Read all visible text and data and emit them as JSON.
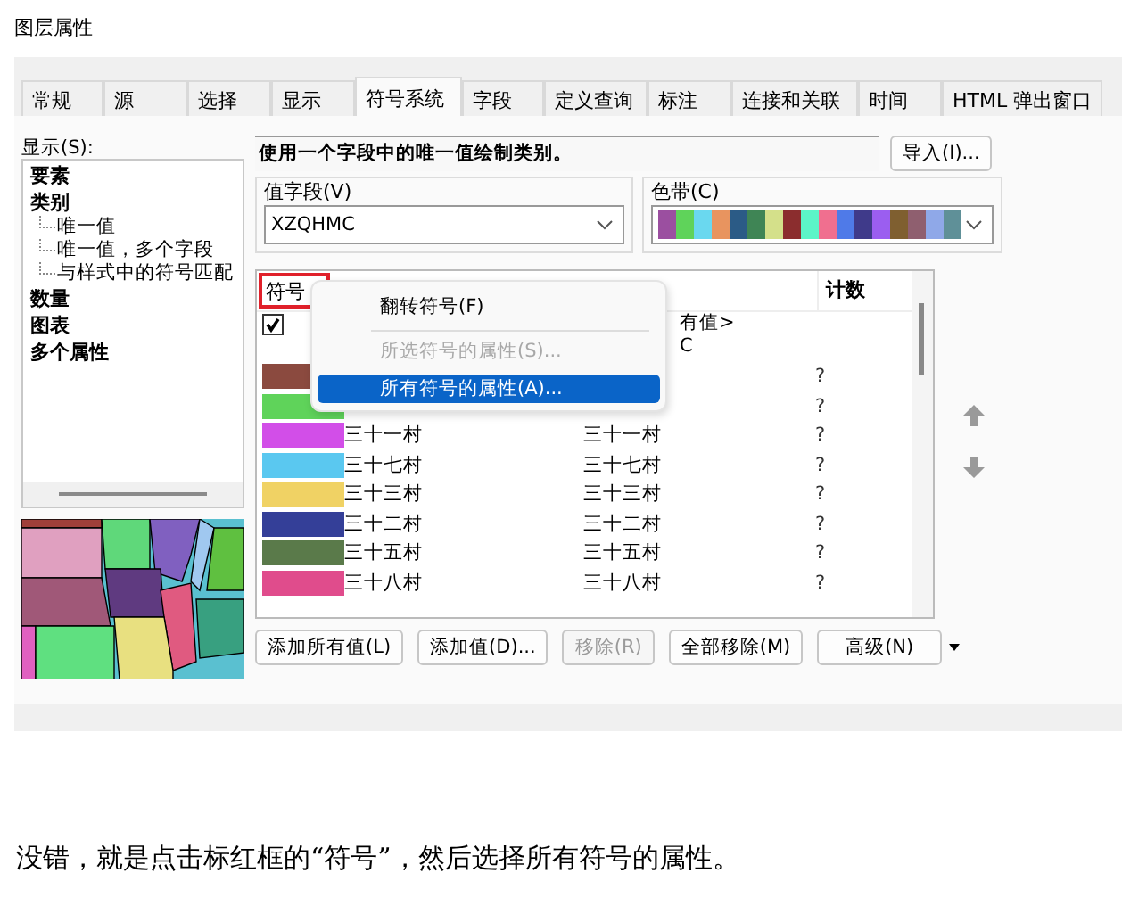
{
  "window": {
    "title": "图层属性"
  },
  "tabs": [
    {
      "label": "常规",
      "selected": false
    },
    {
      "label": "源",
      "selected": false
    },
    {
      "label": "选择",
      "selected": false
    },
    {
      "label": "显示",
      "selected": false
    },
    {
      "label": "符号系统",
      "selected": true
    },
    {
      "label": "字段",
      "selected": false
    },
    {
      "label": "定义查询",
      "selected": false
    },
    {
      "label": "标注",
      "selected": false
    },
    {
      "label": "连接和关联",
      "selected": false
    },
    {
      "label": "时间",
      "selected": false
    },
    {
      "label": "HTML 弹出窗口",
      "selected": false
    }
  ],
  "show": {
    "label": "显示(S):",
    "items": [
      {
        "label": "要素"
      },
      {
        "label": "类别",
        "children": [
          {
            "label": "唯一值"
          },
          {
            "label": "唯一值，多个字段"
          },
          {
            "label": "与样式中的符号匹配"
          }
        ]
      },
      {
        "label": "数量"
      },
      {
        "label": "图表"
      },
      {
        "label": "多个属性"
      }
    ]
  },
  "description": "使用一个字段中的唯一值绘制类别。",
  "import_button": "导入(I)...",
  "value_field": {
    "label": "值字段(V)",
    "value": "XZQHMC"
  },
  "color_ramp": {
    "label": "色带(C)"
  },
  "table": {
    "columns": [
      {
        "label": "符号",
        "highlighted": true
      },
      {
        "label": "计数",
        "highlighted": false
      }
    ],
    "other_row": {
      "checked": true,
      "label": "有值>",
      "heading": "C"
    },
    "rows": [
      {
        "color": "#8b4a3f",
        "count": "?"
      },
      {
        "color": "#5fd35a",
        "count": "?"
      },
      {
        "color": "#d24ee8",
        "value": "三十一村",
        "label": "三十一村",
        "count": "?"
      },
      {
        "color": "#5ac8f0",
        "value": "三十七村",
        "label": "三十七村",
        "count": "?"
      },
      {
        "color": "#f0d264",
        "value": "三十三村",
        "label": "三十三村",
        "count": "?"
      },
      {
        "color": "#343f98",
        "value": "三十二村",
        "label": "三十二村",
        "count": "?"
      },
      {
        "color": "#5a7a4a",
        "value": "三十五村",
        "label": "三十五村",
        "count": "?"
      },
      {
        "color": "#e04c8c",
        "value": "三十八村",
        "label": "三十八村",
        "count": "?"
      }
    ]
  },
  "context_menu": [
    {
      "label": "翻转符号(F)",
      "disabled": false,
      "selected": false
    },
    {
      "label": "所选符号的属性(S)...",
      "disabled": true,
      "selected": false
    },
    {
      "label": "所有符号的属性(A)...",
      "disabled": false,
      "selected": true
    }
  ],
  "buttons": [
    {
      "label": "添加所有值(L)",
      "disabled": false
    },
    {
      "label": "添加值(D)...",
      "disabled": false
    },
    {
      "label": "移除(R)",
      "disabled": true
    },
    {
      "label": "全部移除(M)",
      "disabled": false
    },
    {
      "label": "高级(N)",
      "disabled": false
    }
  ],
  "caption": "没错，就是点击标红框的“符号”，然后选择所有符号的属性。"
}
